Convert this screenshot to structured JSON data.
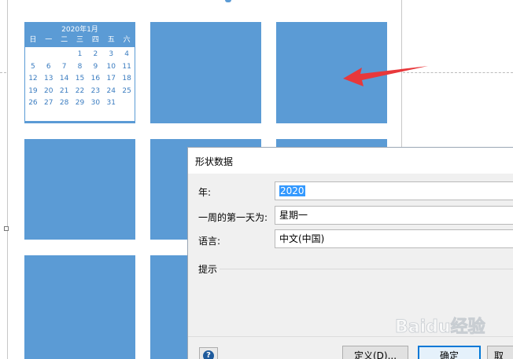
{
  "calendar": {
    "title": "2020年1月",
    "weekdays": [
      "日",
      "一",
      "二",
      "三",
      "四",
      "五",
      "六"
    ],
    "weeks": [
      [
        "",
        "",
        "",
        "1",
        "2",
        "3",
        "4"
      ],
      [
        "5",
        "6",
        "7",
        "8",
        "9",
        "10",
        "11"
      ],
      [
        "12",
        "13",
        "14",
        "15",
        "16",
        "17",
        "18"
      ],
      [
        "19",
        "20",
        "21",
        "22",
        "23",
        "24",
        "25"
      ],
      [
        "26",
        "27",
        "28",
        "29",
        "30",
        "31",
        ""
      ]
    ]
  },
  "colors": {
    "tile": "#5b9bd5",
    "arrow": "#e8383b",
    "primary_border": "#0078d7",
    "selection": "#3399ff"
  },
  "dialog": {
    "title": "形状数据",
    "fields": {
      "year": {
        "label": "年:",
        "value": "2020"
      },
      "first_day": {
        "label": "一周的第一天为:",
        "value": "星期一"
      },
      "language": {
        "label": "语言:",
        "value": "中文(中国)"
      }
    },
    "hint_label": "提示",
    "help_icon": "question-icon",
    "buttons": {
      "define": "定义(D)...",
      "ok": "确定",
      "cancel": "取"
    }
  },
  "watermark": {
    "text": "Baidu经验"
  }
}
